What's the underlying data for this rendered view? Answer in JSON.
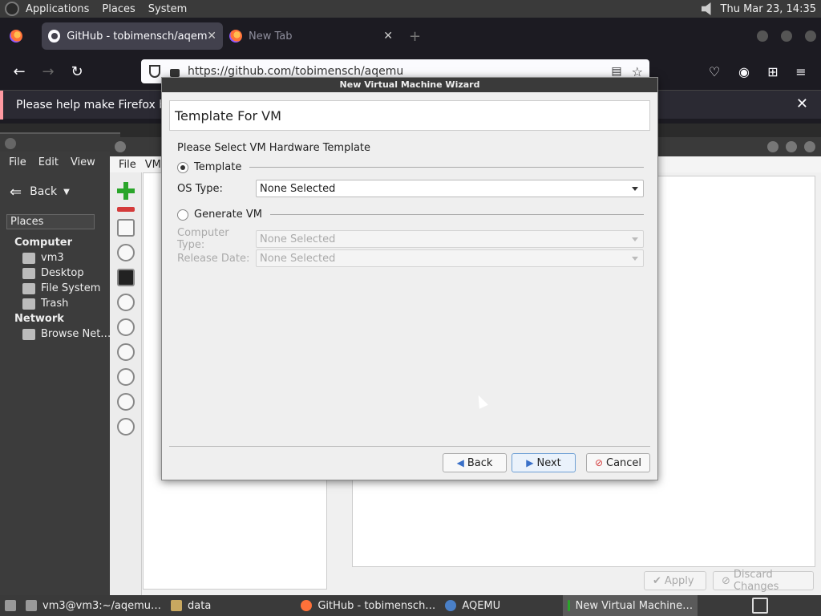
{
  "top_panel": {
    "menus": [
      "Applications",
      "Places",
      "System"
    ],
    "clock": "Thu Mar 23, 14:35"
  },
  "firefox": {
    "tabs": [
      {
        "title": "GitHub - tobimensch/aqemu",
        "active": true
      },
      {
        "title": "New Tab",
        "active": false
      }
    ],
    "url": "https://github.com/tobimensch/aqemu",
    "notification": "Please help make Firefox better"
  },
  "file_manager": {
    "menus": [
      "File",
      "Edit",
      "View"
    ],
    "back_label": "Back",
    "places_label": "Places",
    "sections": [
      {
        "header": "Computer",
        "items": [
          "vm3",
          "Desktop",
          "File System",
          "Trash"
        ]
      },
      {
        "header": "Network",
        "items": [
          "Browse Net…"
        ]
      }
    ]
  },
  "aqemu": {
    "menus": [
      "File",
      "VM"
    ],
    "apply_label": "Apply",
    "discard_label": "Discard Changes"
  },
  "dialog": {
    "title": "New Virtual Machine Wizard",
    "header": "Template For VM",
    "subtitle": "Please Select VM Hardware Template",
    "template_radio": "Template",
    "os_type_label": "OS Type:",
    "os_type_value": "None Selected",
    "generate_radio": "Generate VM",
    "computer_type_label": "Computer Type:",
    "computer_type_value": "None Selected",
    "release_date_label": "Release Date:",
    "release_date_value": "None Selected",
    "back_button": "Back",
    "next_button": "Next",
    "cancel_button": "Cancel"
  },
  "taskbar": {
    "items": [
      "vm3@vm3:~/aqemu…",
      "data",
      "GitHub - tobimensch…",
      "AQEMU",
      "New Virtual Machine…"
    ]
  }
}
